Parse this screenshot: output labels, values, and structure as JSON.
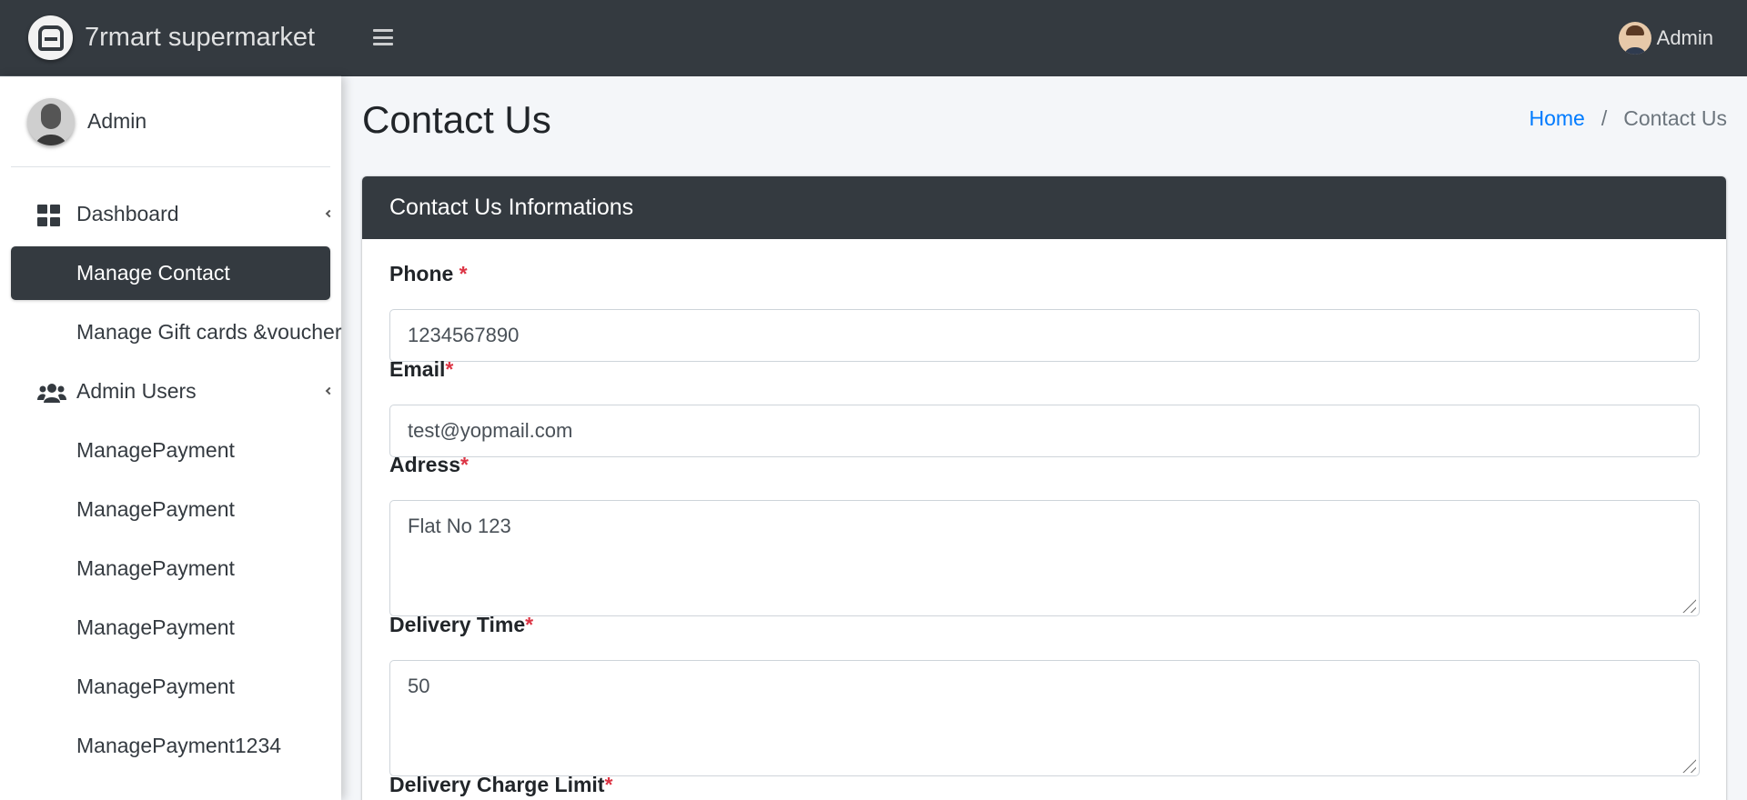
{
  "brand": {
    "name": "7rmart supermarket",
    "logo_icon": "brand-logo-icon"
  },
  "topbar": {
    "menu_icon": "hamburger-icon",
    "user_name": "Admin"
  },
  "sidebar": {
    "user_name": "Admin",
    "items": [
      {
        "label": "Dashboard",
        "icon": "dashboard-grid-icon",
        "has_caret": true,
        "active": false
      },
      {
        "label": "Manage Contact",
        "icon": "",
        "has_caret": false,
        "active": true
      },
      {
        "label": "Manage Gift cards &voucher",
        "icon": "",
        "has_caret": false,
        "active": false
      },
      {
        "label": "Admin Users",
        "icon": "users-icon",
        "has_caret": true,
        "active": false
      },
      {
        "label": "ManagePayment",
        "icon": "",
        "has_caret": false,
        "active": false
      },
      {
        "label": "ManagePayment",
        "icon": "",
        "has_caret": false,
        "active": false
      },
      {
        "label": "ManagePayment",
        "icon": "",
        "has_caret": false,
        "active": false
      },
      {
        "label": "ManagePayment",
        "icon": "",
        "has_caret": false,
        "active": false
      },
      {
        "label": "ManagePayment",
        "icon": "",
        "has_caret": false,
        "active": false
      },
      {
        "label": "ManagePayment1234",
        "icon": "",
        "has_caret": false,
        "active": false
      }
    ]
  },
  "page": {
    "title": "Contact Us",
    "breadcrumb": {
      "home": "Home",
      "separator": "/",
      "current": "Contact Us"
    }
  },
  "card": {
    "title": "Contact Us Informations",
    "fields": {
      "phone": {
        "label": "Phone",
        "required_mark": "*",
        "value": "1234567890"
      },
      "email": {
        "label": "Email",
        "required_mark": "*",
        "value": "test@yopmail.com"
      },
      "address": {
        "label": "Adress",
        "required_mark": "*",
        "value": "Flat No 123"
      },
      "delivery_time": {
        "label": "Delivery Time",
        "required_mark": "*",
        "value": "50"
      },
      "delivery_charge_limit": {
        "label": "Delivery Charge Limit",
        "required_mark": "*"
      }
    }
  },
  "colors": {
    "dark": "#343a40",
    "link": "#007bff",
    "required": "#dc3545",
    "background": "#f4f6f9"
  }
}
